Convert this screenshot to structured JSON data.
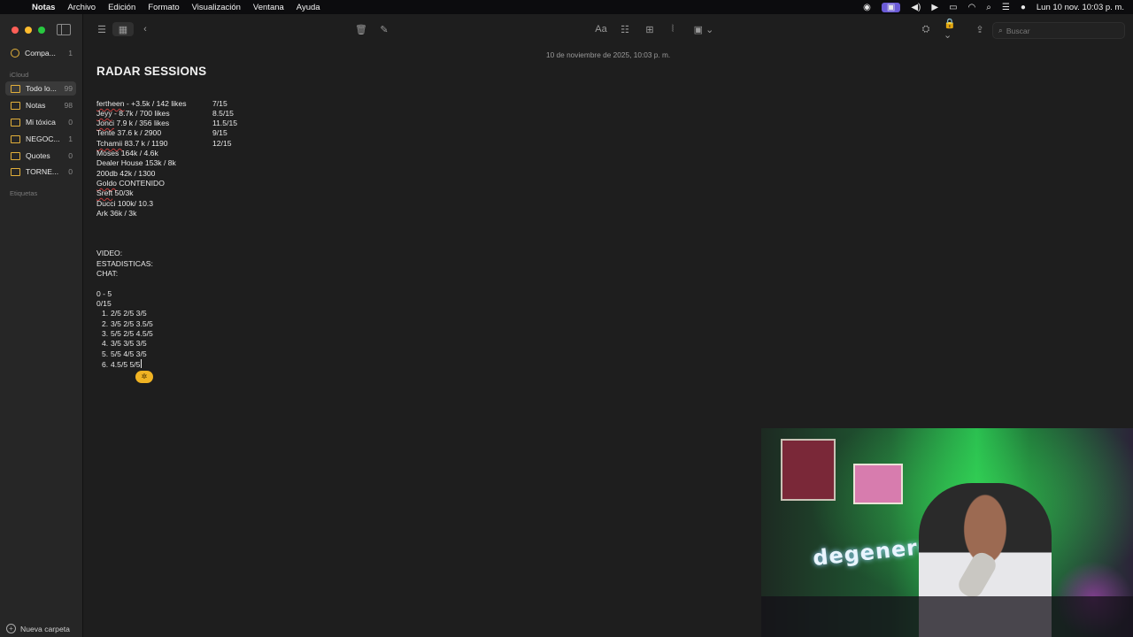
{
  "menubar": {
    "app": "Notas",
    "items": [
      "Archivo",
      "Edición",
      "Formato",
      "Visualización",
      "Ventana",
      "Ayuda"
    ],
    "clock": "Lun 10 nov.  10:03 p. m."
  },
  "sidebar": {
    "shared": {
      "label": "Compa...",
      "count": "1"
    },
    "section_icloud": "iCloud",
    "folders": [
      {
        "label": "Todo lo...",
        "count": "99",
        "selected": true
      },
      {
        "label": "Notas",
        "count": "98"
      },
      {
        "label": "Mi tóxica",
        "count": "0"
      },
      {
        "label": "NEGOC...",
        "count": "1"
      },
      {
        "label": "Quotes",
        "count": "0"
      },
      {
        "label": "TORNE...",
        "count": "0"
      }
    ],
    "section_tags": "Etiquetas",
    "new_folder": "Nueva carpeta"
  },
  "toolbar": {
    "format_label": "Aa",
    "search_placeholder": "Buscar"
  },
  "note": {
    "date": "10 de noviembre de 2025, 10:03 p. m.",
    "title": "RADAR SESSIONS",
    "lines": [
      {
        "u": "fertheen",
        "t": " - +3.5k / 142 likes",
        "s": "7/15"
      },
      {
        "u": "Jeyy",
        "t": " - 8.7k / 700 likes",
        "s": "8.5/15"
      },
      {
        "u": "Jonci",
        "t": " 7.9 k / 356 likes",
        "s": "11.5/15"
      },
      {
        "u": "",
        "t": "Tente 37.6 k / 2900",
        "s": "9/15"
      },
      {
        "u": "Tchamii",
        "t": " 83.7 k / 1190",
        "s": "12/15"
      },
      {
        "u": "",
        "t": "Moses 164k / 4.6k",
        "s": ""
      },
      {
        "u": "",
        "t": "Dealer House 153k / 8k",
        "s": ""
      },
      {
        "u": "",
        "t": "200db 42k / 1300",
        "s": ""
      },
      {
        "u": "Goldo",
        "t": " CONTENIDO",
        "s": ""
      },
      {
        "u": "Sreft",
        "t": " 50/3k",
        "s": ""
      },
      {
        "u": "",
        "t": "Ducci 100k/ 10.3",
        "s": ""
      },
      {
        "u": "",
        "t": "Ark 36k / 3k",
        "s": ""
      }
    ],
    "video": "VIDEO:",
    "estadisticas": "ESTADISTICAS:",
    "chat": "CHAT:",
    "range": "0 - 5",
    "score": "0/15",
    "list": [
      {
        "n": "1.",
        "t": "2/5 2/5 3/5"
      },
      {
        "n": "2.",
        "t": "3/5 2/5 3.5/5"
      },
      {
        "n": "3.",
        "t": "5/5 2/5 4.5/5"
      },
      {
        "n": "4.",
        "t": "3/5 3/5 3/5"
      },
      {
        "n": "5.",
        "t": "5/5 4/5 3/5"
      },
      {
        "n": "6.",
        "t": "4.5/5 5/5"
      }
    ]
  },
  "webcam": {
    "neon_sign": "degenere"
  },
  "colors": {
    "accent": "#f0b323",
    "folder": "#e3b03a",
    "background": "#1e1e1e"
  }
}
